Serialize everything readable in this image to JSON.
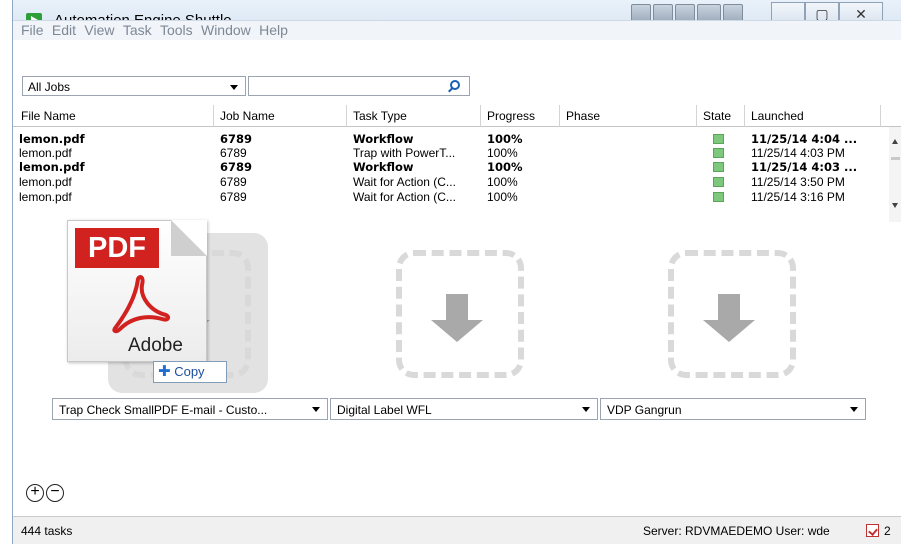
{
  "window": {
    "title": "Automation Engine Shuttle"
  },
  "menu": {
    "items": [
      "File",
      "Edit",
      "View",
      "Task",
      "Tools",
      "Window",
      "Help"
    ]
  },
  "filter": {
    "selected": "All Jobs",
    "search_value": ""
  },
  "table": {
    "columns": [
      "File Name",
      "Job Name",
      "Task Type",
      "Progress",
      "Phase",
      "State",
      "Launched"
    ],
    "rows": [
      {
        "file": "lemon.pdf",
        "job": "6789",
        "task": "Workflow",
        "progress": "100%",
        "phase": "",
        "launched": "11/25/14 4:04 ...",
        "bold": true
      },
      {
        "file": "lemon.pdf",
        "job": "6789",
        "task": "Trap with PowerT...",
        "progress": "100%",
        "phase": "",
        "launched": "11/25/14 4:03 PM",
        "bold": false
      },
      {
        "file": "lemon.pdf",
        "job": "6789",
        "task": "Workflow",
        "progress": "100%",
        "phase": "",
        "launched": "11/25/14 4:03 ...",
        "bold": true
      },
      {
        "file": "lemon.pdf",
        "job": "6789",
        "task": "Wait for Action (C...",
        "progress": "100%",
        "phase": "",
        "launched": "11/25/14 3:50 PM",
        "bold": false
      },
      {
        "file": "lemon.pdf",
        "job": "6789",
        "task": "Wait for Action (C...",
        "progress": "100%",
        "phase": "",
        "launched": "11/25/14 3:16 PM",
        "bold": false
      }
    ]
  },
  "drag": {
    "pdf_badge": "PDF",
    "brand": "Adobe",
    "copy_label": "Copy"
  },
  "dropzones": [
    {
      "ticket": "Trap Check SmallPDF E-mail - Custo..."
    },
    {
      "ticket": "Digital Label WFL"
    },
    {
      "ticket": "VDP Gangrun"
    }
  ],
  "controls": {
    "add_symbol": "+",
    "remove_symbol": "−"
  },
  "status": {
    "tasks": "444 tasks",
    "server": "Server: RDVMAEDEMO  User: wde",
    "task_count": "2"
  },
  "colors": {
    "state_ok": "#7ec87e",
    "pdf_red": "#d1221f",
    "arrow_gray": "#a9a9a9"
  }
}
